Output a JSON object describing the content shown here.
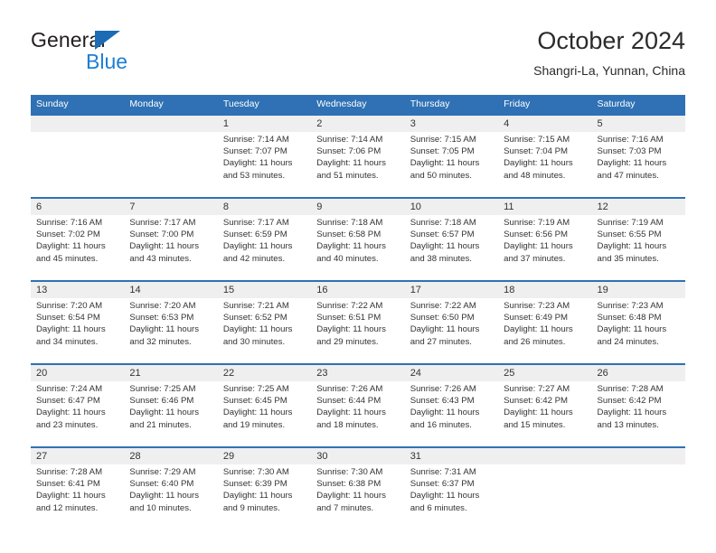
{
  "brand": {
    "word1": "General",
    "word2": "Blue",
    "triangle_color": "#1c6cb5",
    "blue_color": "#1c7fd4"
  },
  "header": {
    "title": "October 2024",
    "subtitle": "Shangri-La, Yunnan, China"
  },
  "theme": {
    "header_blue": "#2f71b4",
    "daynum_band": "#efefef",
    "text": "#333333"
  },
  "weekdays": [
    "Sunday",
    "Monday",
    "Tuesday",
    "Wednesday",
    "Thursday",
    "Friday",
    "Saturday"
  ],
  "weeks": [
    [
      {
        "day": "",
        "sunrise": "",
        "sunset": "",
        "daylight": ""
      },
      {
        "day": "",
        "sunrise": "",
        "sunset": "",
        "daylight": ""
      },
      {
        "day": "1",
        "sunrise": "Sunrise: 7:14 AM",
        "sunset": "Sunset: 7:07 PM",
        "daylight": "Daylight: 11 hours and 53 minutes."
      },
      {
        "day": "2",
        "sunrise": "Sunrise: 7:14 AM",
        "sunset": "Sunset: 7:06 PM",
        "daylight": "Daylight: 11 hours and 51 minutes."
      },
      {
        "day": "3",
        "sunrise": "Sunrise: 7:15 AM",
        "sunset": "Sunset: 7:05 PM",
        "daylight": "Daylight: 11 hours and 50 minutes."
      },
      {
        "day": "4",
        "sunrise": "Sunrise: 7:15 AM",
        "sunset": "Sunset: 7:04 PM",
        "daylight": "Daylight: 11 hours and 48 minutes."
      },
      {
        "day": "5",
        "sunrise": "Sunrise: 7:16 AM",
        "sunset": "Sunset: 7:03 PM",
        "daylight": "Daylight: 11 hours and 47 minutes."
      }
    ],
    [
      {
        "day": "6",
        "sunrise": "Sunrise: 7:16 AM",
        "sunset": "Sunset: 7:02 PM",
        "daylight": "Daylight: 11 hours and 45 minutes."
      },
      {
        "day": "7",
        "sunrise": "Sunrise: 7:17 AM",
        "sunset": "Sunset: 7:00 PM",
        "daylight": "Daylight: 11 hours and 43 minutes."
      },
      {
        "day": "8",
        "sunrise": "Sunrise: 7:17 AM",
        "sunset": "Sunset: 6:59 PM",
        "daylight": "Daylight: 11 hours and 42 minutes."
      },
      {
        "day": "9",
        "sunrise": "Sunrise: 7:18 AM",
        "sunset": "Sunset: 6:58 PM",
        "daylight": "Daylight: 11 hours and 40 minutes."
      },
      {
        "day": "10",
        "sunrise": "Sunrise: 7:18 AM",
        "sunset": "Sunset: 6:57 PM",
        "daylight": "Daylight: 11 hours and 38 minutes."
      },
      {
        "day": "11",
        "sunrise": "Sunrise: 7:19 AM",
        "sunset": "Sunset: 6:56 PM",
        "daylight": "Daylight: 11 hours and 37 minutes."
      },
      {
        "day": "12",
        "sunrise": "Sunrise: 7:19 AM",
        "sunset": "Sunset: 6:55 PM",
        "daylight": "Daylight: 11 hours and 35 minutes."
      }
    ],
    [
      {
        "day": "13",
        "sunrise": "Sunrise: 7:20 AM",
        "sunset": "Sunset: 6:54 PM",
        "daylight": "Daylight: 11 hours and 34 minutes."
      },
      {
        "day": "14",
        "sunrise": "Sunrise: 7:20 AM",
        "sunset": "Sunset: 6:53 PM",
        "daylight": "Daylight: 11 hours and 32 minutes."
      },
      {
        "day": "15",
        "sunrise": "Sunrise: 7:21 AM",
        "sunset": "Sunset: 6:52 PM",
        "daylight": "Daylight: 11 hours and 30 minutes."
      },
      {
        "day": "16",
        "sunrise": "Sunrise: 7:22 AM",
        "sunset": "Sunset: 6:51 PM",
        "daylight": "Daylight: 11 hours and 29 minutes."
      },
      {
        "day": "17",
        "sunrise": "Sunrise: 7:22 AM",
        "sunset": "Sunset: 6:50 PM",
        "daylight": "Daylight: 11 hours and 27 minutes."
      },
      {
        "day": "18",
        "sunrise": "Sunrise: 7:23 AM",
        "sunset": "Sunset: 6:49 PM",
        "daylight": "Daylight: 11 hours and 26 minutes."
      },
      {
        "day": "19",
        "sunrise": "Sunrise: 7:23 AM",
        "sunset": "Sunset: 6:48 PM",
        "daylight": "Daylight: 11 hours and 24 minutes."
      }
    ],
    [
      {
        "day": "20",
        "sunrise": "Sunrise: 7:24 AM",
        "sunset": "Sunset: 6:47 PM",
        "daylight": "Daylight: 11 hours and 23 minutes."
      },
      {
        "day": "21",
        "sunrise": "Sunrise: 7:25 AM",
        "sunset": "Sunset: 6:46 PM",
        "daylight": "Daylight: 11 hours and 21 minutes."
      },
      {
        "day": "22",
        "sunrise": "Sunrise: 7:25 AM",
        "sunset": "Sunset: 6:45 PM",
        "daylight": "Daylight: 11 hours and 19 minutes."
      },
      {
        "day": "23",
        "sunrise": "Sunrise: 7:26 AM",
        "sunset": "Sunset: 6:44 PM",
        "daylight": "Daylight: 11 hours and 18 minutes."
      },
      {
        "day": "24",
        "sunrise": "Sunrise: 7:26 AM",
        "sunset": "Sunset: 6:43 PM",
        "daylight": "Daylight: 11 hours and 16 minutes."
      },
      {
        "day": "25",
        "sunrise": "Sunrise: 7:27 AM",
        "sunset": "Sunset: 6:42 PM",
        "daylight": "Daylight: 11 hours and 15 minutes."
      },
      {
        "day": "26",
        "sunrise": "Sunrise: 7:28 AM",
        "sunset": "Sunset: 6:42 PM",
        "daylight": "Daylight: 11 hours and 13 minutes."
      }
    ],
    [
      {
        "day": "27",
        "sunrise": "Sunrise: 7:28 AM",
        "sunset": "Sunset: 6:41 PM",
        "daylight": "Daylight: 11 hours and 12 minutes."
      },
      {
        "day": "28",
        "sunrise": "Sunrise: 7:29 AM",
        "sunset": "Sunset: 6:40 PM",
        "daylight": "Daylight: 11 hours and 10 minutes."
      },
      {
        "day": "29",
        "sunrise": "Sunrise: 7:30 AM",
        "sunset": "Sunset: 6:39 PM",
        "daylight": "Daylight: 11 hours and 9 minutes."
      },
      {
        "day": "30",
        "sunrise": "Sunrise: 7:30 AM",
        "sunset": "Sunset: 6:38 PM",
        "daylight": "Daylight: 11 hours and 7 minutes."
      },
      {
        "day": "31",
        "sunrise": "Sunrise: 7:31 AM",
        "sunset": "Sunset: 6:37 PM",
        "daylight": "Daylight: 11 hours and 6 minutes."
      },
      {
        "day": "",
        "sunrise": "",
        "sunset": "",
        "daylight": ""
      },
      {
        "day": "",
        "sunrise": "",
        "sunset": "",
        "daylight": ""
      }
    ]
  ]
}
